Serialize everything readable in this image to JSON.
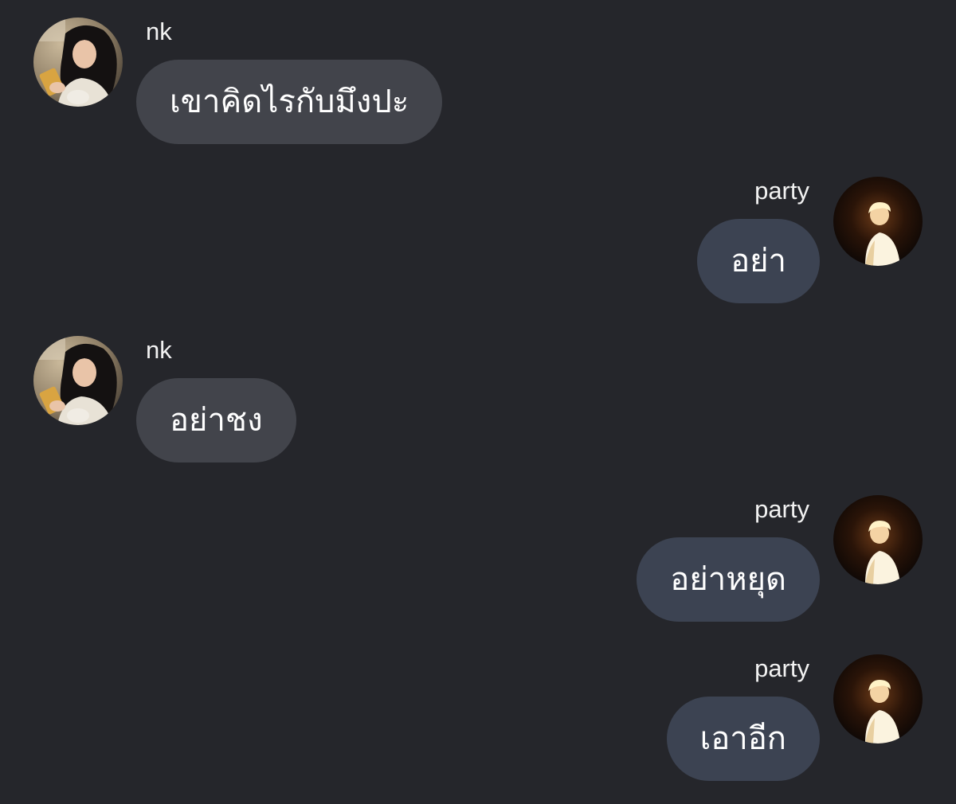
{
  "messages": [
    {
      "sender": "nk",
      "side": "left",
      "text": "เขาคิดไรกับมึงปะ",
      "avatar": "girl-photo"
    },
    {
      "sender": "party",
      "side": "right",
      "text": "อย่า",
      "avatar": "boy-photo"
    },
    {
      "sender": "nk",
      "side": "left",
      "text": "อย่าชง",
      "avatar": "girl-photo"
    },
    {
      "sender": "party",
      "side": "right",
      "text": "อย่าหยุด",
      "avatar": "boy-photo"
    },
    {
      "sender": "party",
      "side": "right",
      "text": "เอาอีก",
      "avatar": "boy-photo"
    }
  ],
  "colors": {
    "background": "#25262b",
    "incoming_bubble": "#42444b",
    "outgoing_bubble": "#3c4352",
    "text": "#ffffff"
  }
}
